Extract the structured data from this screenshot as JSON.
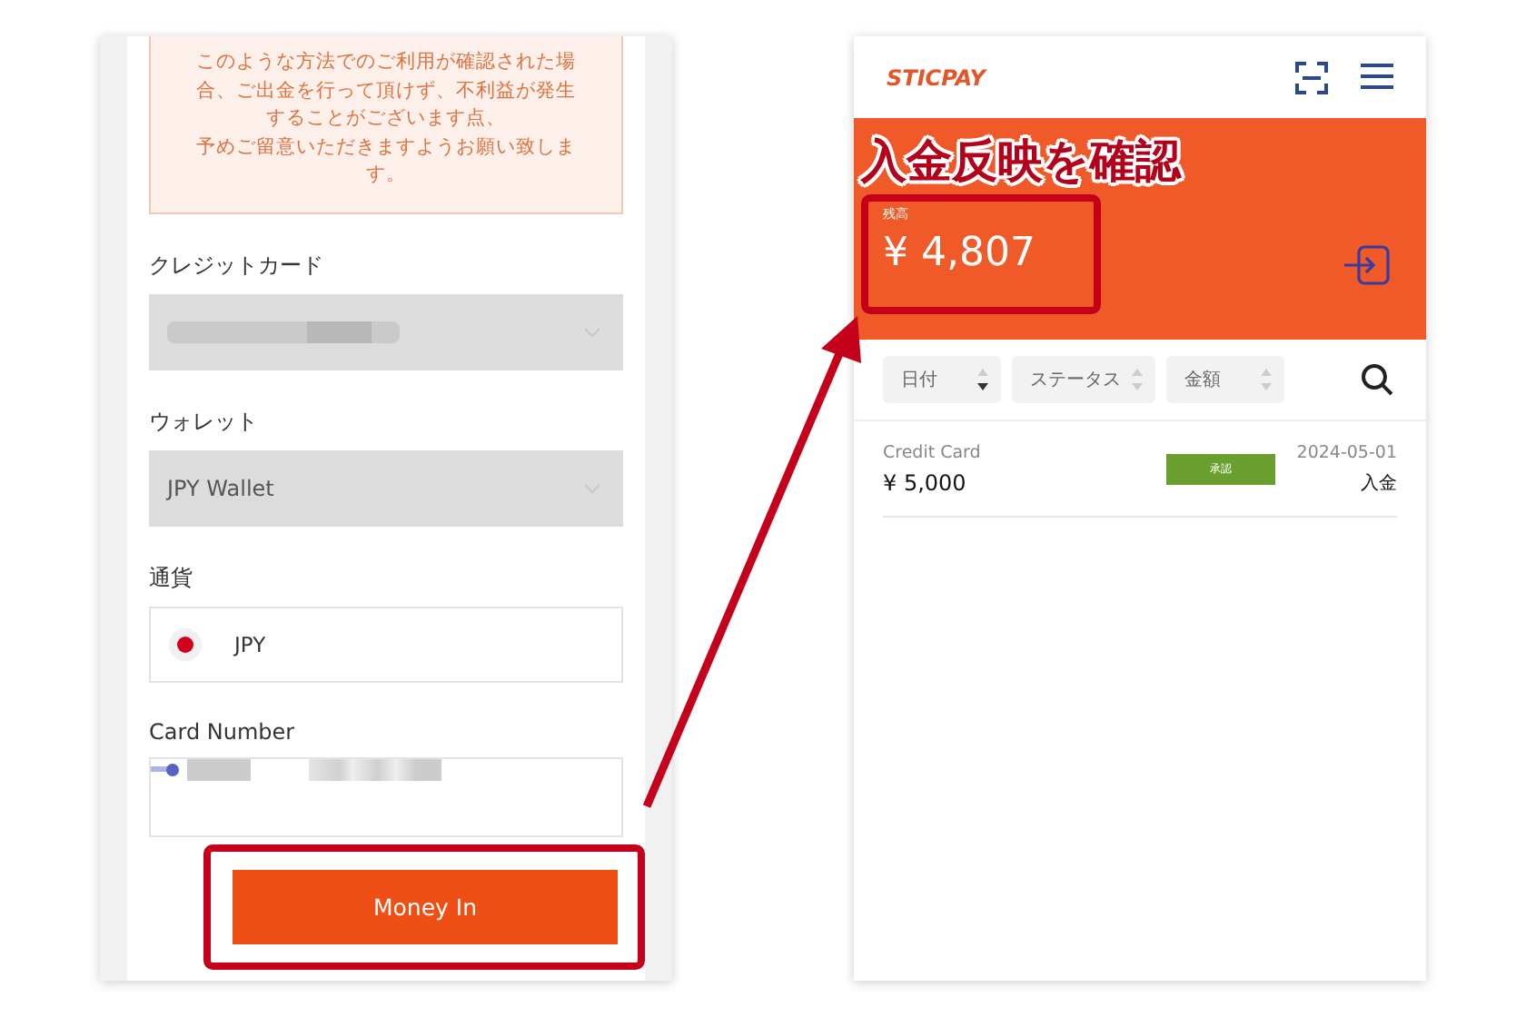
{
  "left_screen": {
    "notice": {
      "lines": [
        "このような方法でのご利用が確認された場",
        "合、ご出金を行って頂けず、不利益が発生",
        "することがございます点、",
        "予めご留意いただきますようお願い致しま",
        "す。"
      ]
    },
    "fields": [
      {
        "kind": "select",
        "label": "クレジットカード",
        "redacted": true
      },
      {
        "kind": "select",
        "label": "ウォレット",
        "value": "JPY Wallet"
      },
      {
        "kind": "currency",
        "label": "通貨",
        "value": "JPY"
      },
      {
        "kind": "card",
        "label": "Card Number",
        "redacted": true
      }
    ],
    "button": {
      "label": "Money In",
      "highlighted": true
    }
  },
  "right_screen": {
    "logo": "STICPAY",
    "annotation": "入金反映を確認",
    "balance": {
      "label": "残高",
      "amount": "¥ 4,807",
      "highlighted": true
    },
    "filters": [
      "日付",
      "ステータス",
      "金額"
    ],
    "transactions": [
      {
        "method": "Credit Card",
        "amount": "¥ 5,000",
        "status": "承認",
        "color": "#6a9e2e",
        "date": "2024-05-01",
        "type": "入金"
      }
    ]
  }
}
